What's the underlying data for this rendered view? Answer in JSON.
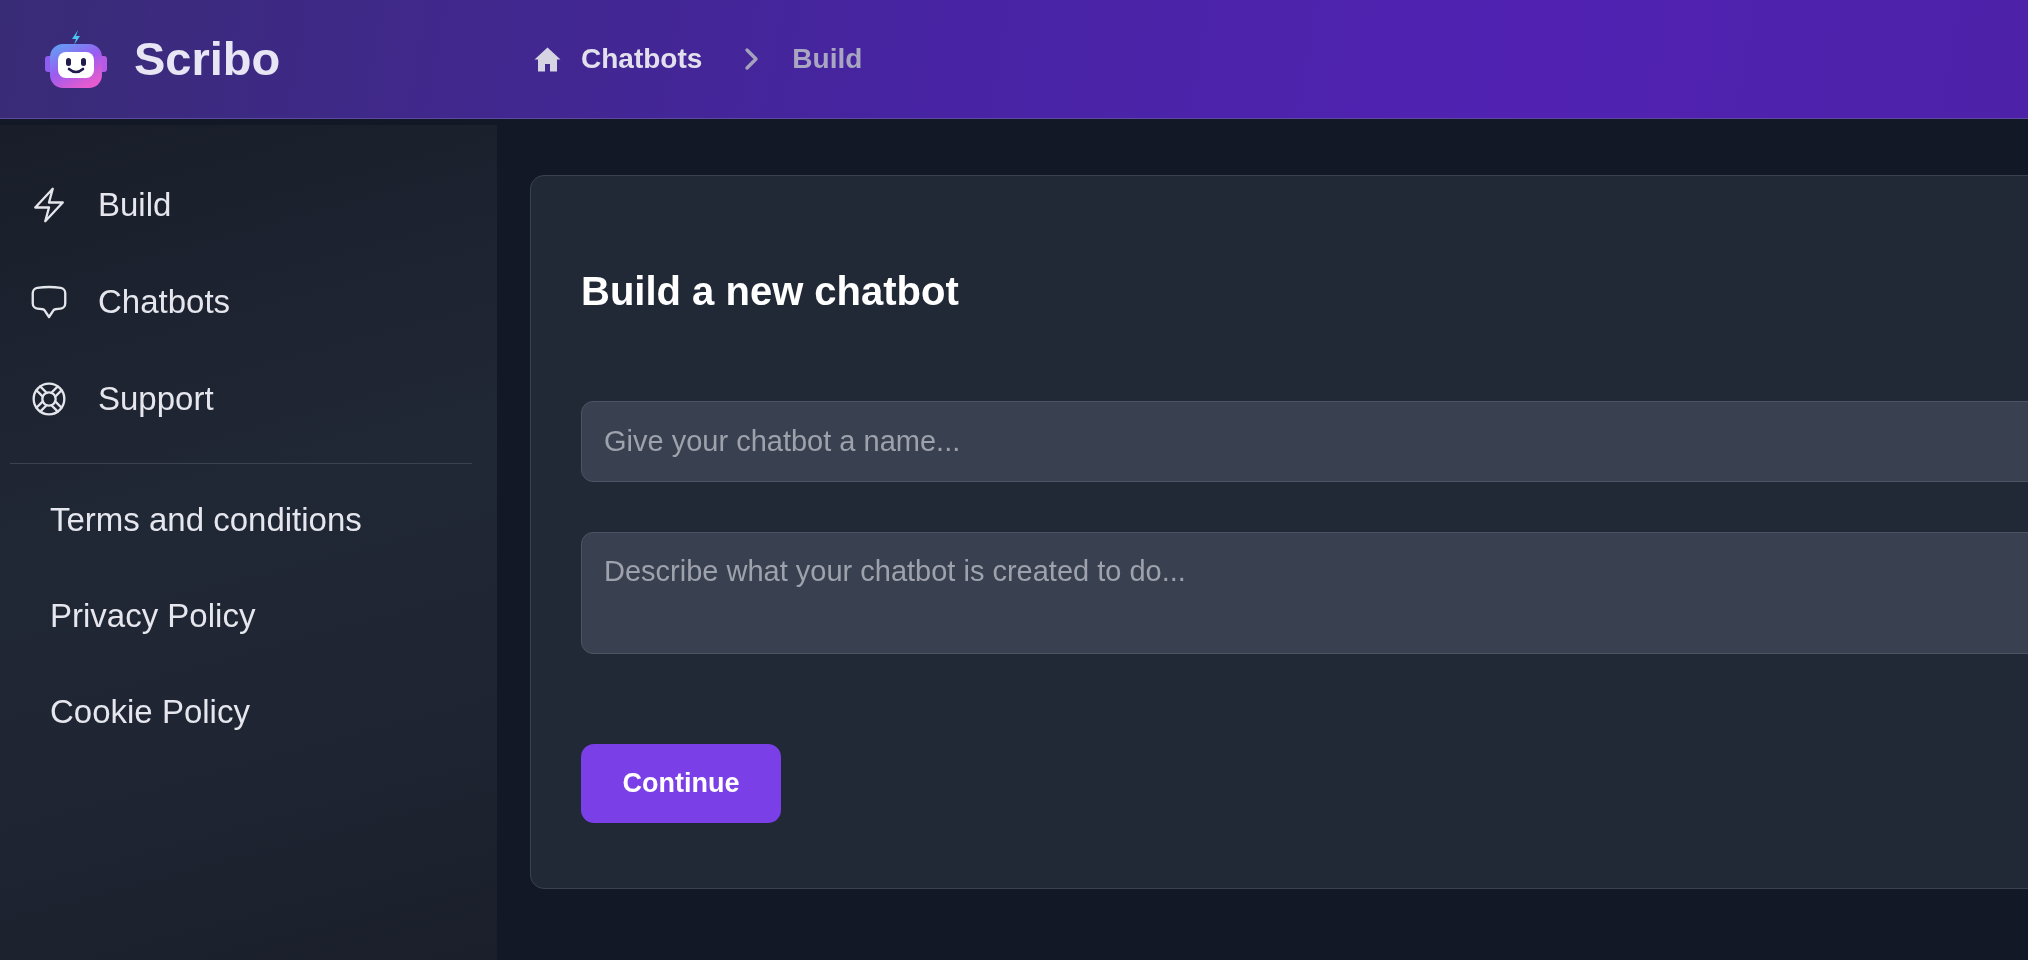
{
  "header": {
    "app_name": "Scribo",
    "breadcrumb": [
      {
        "label": "Chatbots",
        "kind": "home",
        "current": false
      },
      {
        "label": "Build",
        "kind": "page",
        "current": true
      }
    ]
  },
  "sidebar": {
    "nav_items": [
      {
        "label": "Build"
      },
      {
        "label": "Chatbots"
      },
      {
        "label": "Support"
      }
    ],
    "links": [
      {
        "label": "Terms and conditions"
      },
      {
        "label": "Privacy Policy"
      },
      {
        "label": "Cookie Policy"
      }
    ]
  },
  "card": {
    "title": "Build a new chatbot",
    "fields": [
      {
        "kind": "input",
        "placeholder": "Give your chatbot a name..."
      },
      {
        "kind": "textarea",
        "placeholder": "Describe what your chatbot is created to do..."
      }
    ],
    "button": "Continue"
  }
}
